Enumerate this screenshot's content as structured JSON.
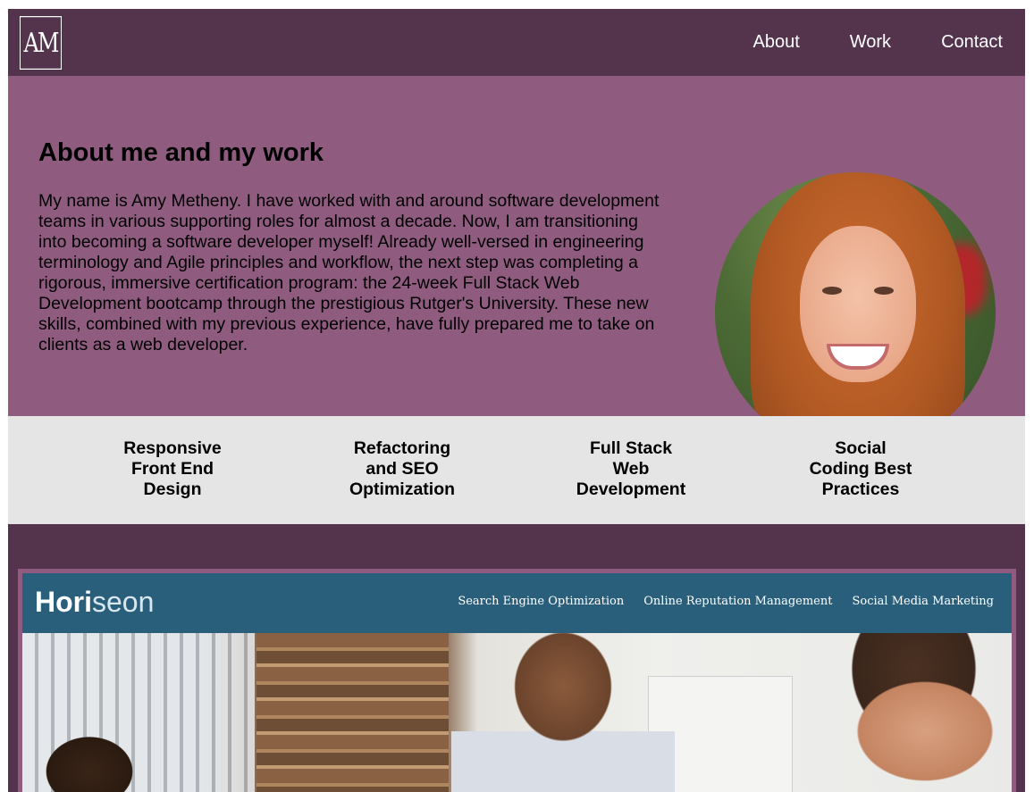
{
  "header": {
    "logo_text": "AM",
    "nav": [
      "About",
      "Work",
      "Contact"
    ]
  },
  "about": {
    "title": "About me and my work",
    "body": "My name is Amy Metheny. I have worked with and around software development teams in various supporting roles for almost a decade. Now, I am transitioning into becoming a software developer myself! Already well-versed in engineering terminology and Agile principles and workflow, the next step was completing a rigorous, immersive certification program: the 24-week Full Stack Web Development bootcamp through the prestigious Rutger's University. These new skills, combined with my previous experience, have fully prepared me to take on clients as a web developer."
  },
  "skills": [
    [
      "Responsive",
      "Front End",
      "Design"
    ],
    [
      "Refactoring",
      "and SEO",
      "Optimization"
    ],
    [
      "Full Stack",
      "Web",
      "Development"
    ],
    [
      "Social",
      "Coding Best",
      "Practices"
    ]
  ],
  "work": {
    "project": {
      "brand_bold": "Hori",
      "brand_light": "seon",
      "nav": [
        "Search Engine Optimization",
        "Online Reputation Management",
        "Social Media Marketing"
      ]
    }
  },
  "colors": {
    "header_bg": "#54344d",
    "about_bg": "#8f5c80",
    "skills_bg": "#e5e5e5",
    "project_bar": "#2a5f7c"
  }
}
